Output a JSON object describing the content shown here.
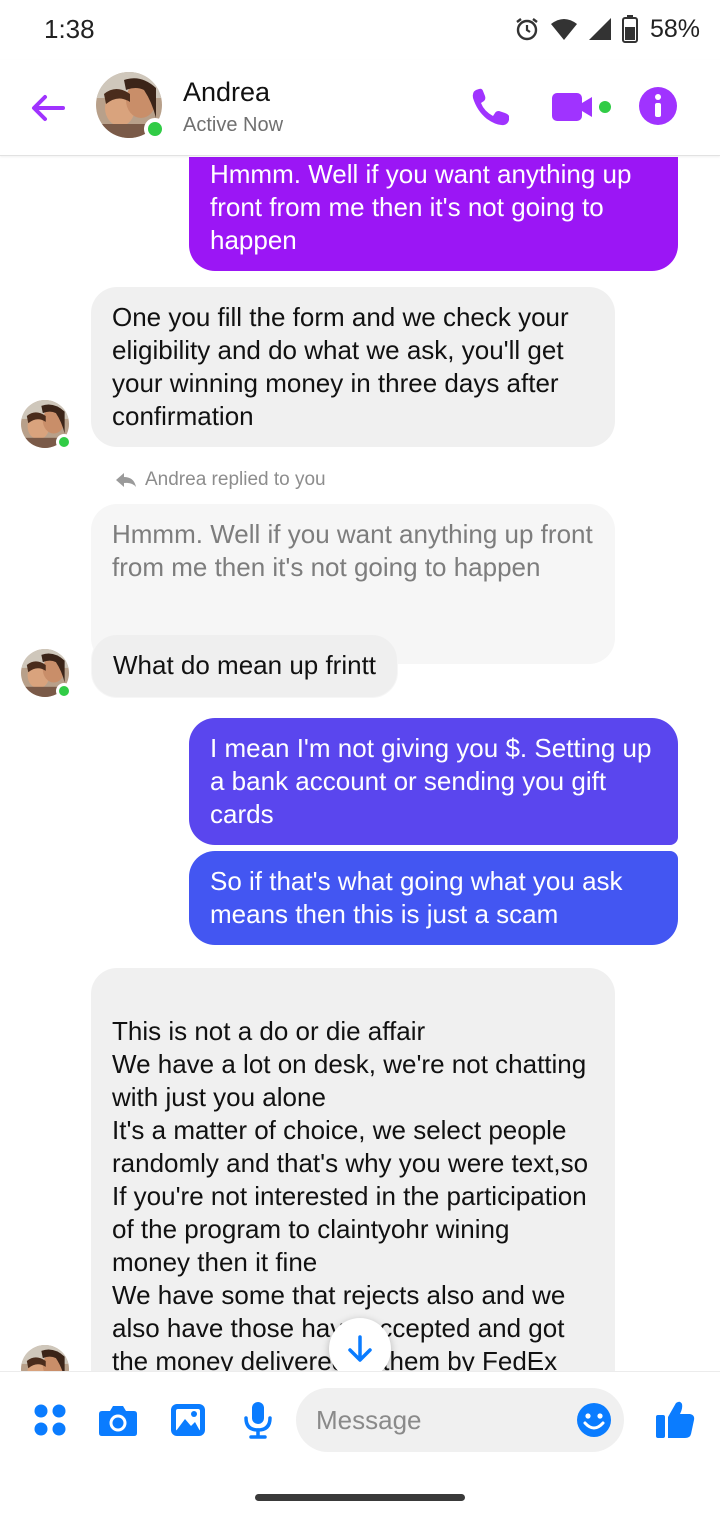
{
  "status_bar": {
    "time": "1:38",
    "battery": "58%",
    "icons": [
      "alarm-icon",
      "wifi-icon",
      "cell-signal-icon",
      "battery-icon"
    ]
  },
  "header": {
    "name": "Andrea",
    "status": "Active Now",
    "accent_color": "#a033ff",
    "icons": [
      "back-arrow-icon",
      "phone-icon",
      "video-camera-icon",
      "info-icon"
    ]
  },
  "messages": [
    {
      "id": 1,
      "from": "me",
      "text": "Hmmm. Well if you want anything up front from me then it's not going to happen",
      "color": "#9b16f5"
    },
    {
      "id": 2,
      "from": "Andrea",
      "text": "One you fill the form and we check your eligibility and do what we ask, you'll get your winning money in three days after confirmation"
    },
    {
      "id": 3,
      "type": "reply_note",
      "text": "Andrea replied to you"
    },
    {
      "id": 4,
      "type": "quoted",
      "text": "Hmmm. Well if you want anything up front from me then it's not going to happen"
    },
    {
      "id": 5,
      "from": "Andrea",
      "text": "What do mean up frintt"
    },
    {
      "id": 6,
      "from": "me",
      "text": "I mean I'm not giving you $. Setting up a bank account or sending you gift cards",
      "color": "#5a46ee"
    },
    {
      "id": 7,
      "from": "me",
      "text": "So if that's what going what you ask means then this is just a scam",
      "color": "#4356f2"
    },
    {
      "id": 8,
      "from": "Andrea",
      "text": "This is not a do or die affair\nWe have a lot on desk, we're not chatting with just you alone\nIt's a matter of choice, we select people randomly and that's why you were text,so If you're not interested in the participation of the program to claintyohr wining money then it fine\nWe have some that rejects also and we also have those have accepted and got the money delivered to them by FedEx"
    }
  ],
  "composer": {
    "placeholder": "Message",
    "icons": [
      "menu-dots-icon",
      "camera-icon",
      "gallery-icon",
      "microphone-icon",
      "emoji-icon",
      "thumbs-up-icon"
    ],
    "icon_color": "#0a7cff"
  }
}
